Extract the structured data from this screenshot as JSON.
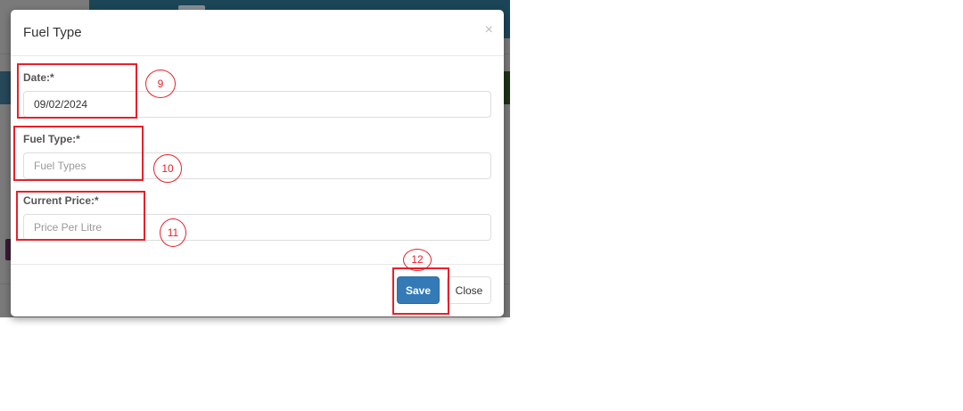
{
  "modal": {
    "title": "Fuel Type",
    "close_icon": "×",
    "fields": [
      {
        "label": "Date:*",
        "value": "09/02/2024",
        "placeholder": ""
      },
      {
        "label": "Fuel Type:*",
        "value": "",
        "placeholder": "Fuel Types"
      },
      {
        "label": "Current Price:*",
        "value": "",
        "placeholder": "Price Per Litre"
      }
    ],
    "save_label": "Save",
    "close_label": "Close"
  },
  "annotations": [
    "9",
    "10",
    "11",
    "12"
  ],
  "colors": {
    "primary": "#337ab7",
    "annotation": "#e8202a",
    "header_bg": "#1b4658"
  }
}
